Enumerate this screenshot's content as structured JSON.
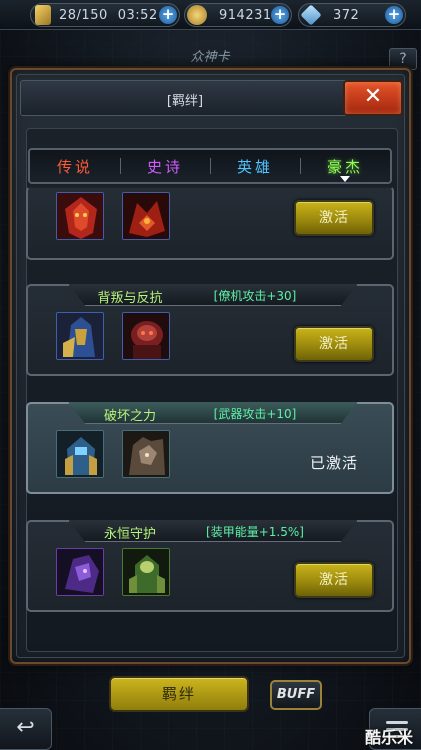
{
  "topbar": {
    "energy": "28/150",
    "time": "03:52",
    "gold": "914231",
    "gems": "372",
    "plus_symbol": "+"
  },
  "screen": {
    "subtitle": "众神卡",
    "help_label": "?"
  },
  "modal": {
    "title": "[羁绊]",
    "close_label": "✕"
  },
  "tabs": [
    {
      "label": "传说",
      "color": "#ff5a36"
    },
    {
      "label": "史诗",
      "color": "#d25cff"
    },
    {
      "label": "英雄",
      "color": "#4fc3ff"
    },
    {
      "label": "豪杰",
      "color": "#8dff4f",
      "selected": true
    }
  ],
  "bonds": [
    {
      "name": "",
      "bonus": "",
      "action_label": "激活",
      "activated": false,
      "portraits": [
        "red-mech-portrait",
        "red-dragon-portrait"
      ]
    },
    {
      "name": "背叛与反抗",
      "bonus": "[僚机攻击+30]",
      "action_label": "激活",
      "activated": false,
      "portraits": [
        "blue-gold-mech-portrait",
        "red-brute-portrait"
      ]
    },
    {
      "name": "破坏之力",
      "bonus": "[武器攻击+10]",
      "status_label": "已激活",
      "activated": true,
      "portraits": [
        "blue-robot-portrait",
        "brown-beast-portrait"
      ]
    },
    {
      "name": "永恒守护",
      "bonus": "[装甲能量+1.5%]",
      "action_label": "激活",
      "activated": false,
      "portraits": [
        "purple-mech-portrait",
        "green-robot-portrait"
      ]
    }
  ],
  "bottom": {
    "bond_label": "羁绊",
    "buff_label": "BUFF",
    "back_label": "↩",
    "watermark": "酷乐米"
  },
  "colors": {
    "button_gold": "#c8b31a",
    "close_red": "#e5542a",
    "bond_name": "#b7f57b",
    "bond_bonus": "#5df0a6"
  }
}
